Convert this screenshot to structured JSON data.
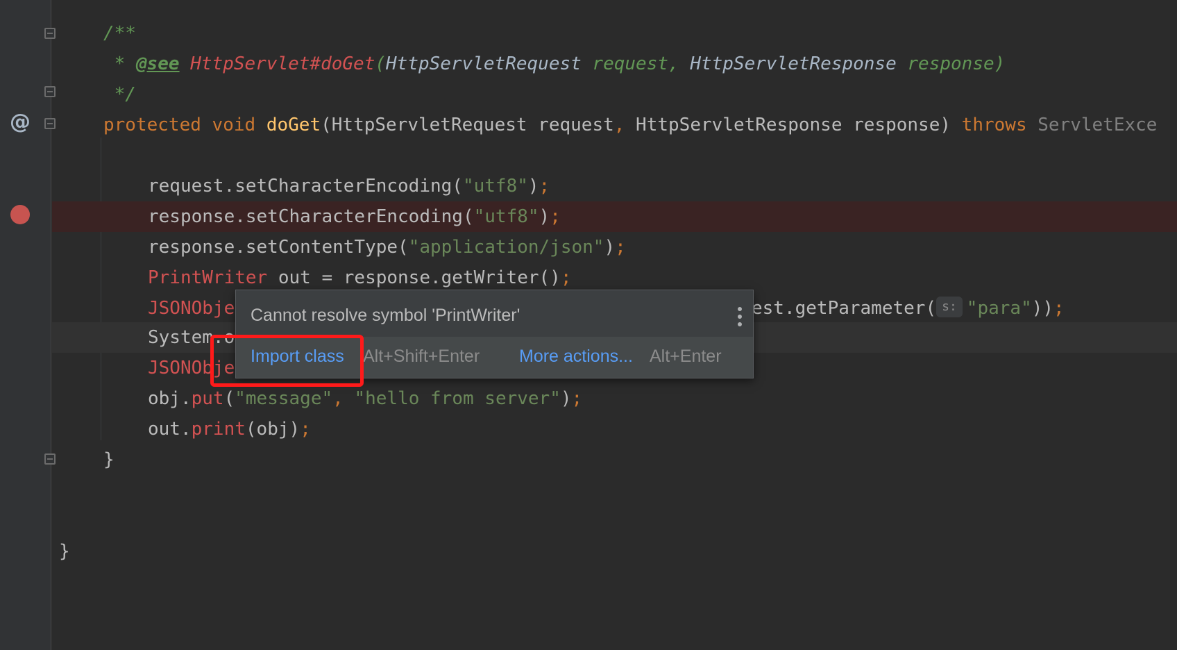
{
  "editor": {
    "javadoc_open": "/**",
    "javadoc_star": " * ",
    "javadoc_tag": "@see",
    "javadoc_ref_class": "HttpServlet#doGet",
    "javadoc_ref_args_open": "(",
    "javadoc_type1": "HttpServletRequest",
    "javadoc_param1": " request, ",
    "javadoc_type2": "HttpServletResponse",
    "javadoc_param2": " response)",
    "javadoc_close": " */",
    "method_kw1": "protected",
    "method_kw2": "void",
    "method_name": "doGet",
    "method_params": "(HttpServletRequest request",
    "method_comma": ",",
    "method_params2": " HttpServletResponse response) ",
    "method_throws": "throws",
    "method_exception": " ServletExce",
    "line_req_enc_pre": "request.setCharacterEncoding(",
    "line_req_enc_str": "\"utf8\"",
    "line_req_enc_post": ")",
    "semicolon": ";",
    "line_resp_enc_pre": "response.setCharacterEncoding(",
    "line_resp_enc_str": "\"utf8\"",
    "line_resp_enc_post": ")",
    "line_ctype_pre": "response.setContentType(",
    "line_ctype_str": "\"application/json\"",
    "line_ctype_post": ")",
    "line_pw_type": "PrintWriter",
    "line_pw_rest": " out = response.getWriter()",
    "line_json1_type": "JSONObje",
    "line_json1_tail": "est.getParameter(",
    "line_json1_hint": "s:",
    "line_json1_str": "\"para\"",
    "line_json1_end": "))",
    "line_sys": "System.o",
    "line_json2_type": "JSONObje",
    "line_put_pre": "obj.",
    "line_put_fn": "put",
    "line_put_open": "(",
    "line_put_str1": "\"message\"",
    "line_put_comma": ", ",
    "line_put_str2": "\"hello from server\"",
    "line_put_close": ")",
    "line_print_pre": "out.",
    "line_print_fn": "print",
    "line_print_args": "(obj)",
    "close_method": "}",
    "close_class": "}"
  },
  "gutter": {
    "override_icon": "@",
    "breakpoint_icon": "breakpoint-icon"
  },
  "popup": {
    "message": "Cannot resolve symbol 'PrintWriter'",
    "import_label": "Import class",
    "import_shortcut": "Alt+Shift+Enter",
    "more_label": "More actions...",
    "more_shortcut": "Alt+Enter",
    "menu_icon": "more-vertical-icon"
  },
  "colors": {
    "background": "#2b2b2b",
    "keyword": "#cc7832",
    "string": "#6a8759",
    "error": "#d25252",
    "link": "#589df6",
    "highlight_box": "#ff1a1a"
  }
}
